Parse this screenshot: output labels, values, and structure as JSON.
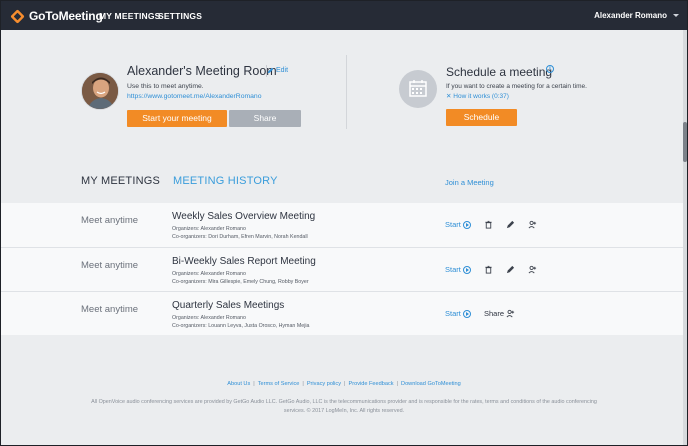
{
  "topbar": {
    "logo_text": "GoToMeeting",
    "nav": [
      "MY MEETINGS",
      "SETTINGS"
    ],
    "user_name": "Alexander Romano"
  },
  "room": {
    "title": "Alexander's Meeting Room",
    "edit_label": "Edit",
    "subtitle": "Use this to meet anytime.",
    "url": "https://www.gotomeet.me/AlexanderRomano",
    "start_label": "Start your meeting",
    "share_label": "Share"
  },
  "schedule": {
    "title": "Schedule a meeting",
    "info_icon": "i",
    "subtitle": "If you want to create a meeting for a certain time.",
    "how_it_works": "How it works (0:37)",
    "button_label": "Schedule"
  },
  "tabs": {
    "my_meetings": "MY MEETINGS",
    "meeting_history": "MEETING HISTORY",
    "join": "Join a Meeting"
  },
  "meetings": [
    {
      "when": "Meet anytime",
      "title": "Weekly Sales Overview Meeting",
      "organizers": "Organizers: Alexander Romano",
      "coorganizers": "Co-organizers: Dori  Durham, Efren Marvin, Norah  Kendall",
      "start_label": "Start",
      "actions": [
        "trash-icon",
        "pencil-icon",
        "add-person-icon"
      ]
    },
    {
      "when": "Meet anytime",
      "title": "Bi-Weekly Sales Report Meeting",
      "organizers": "Organizers: Alexander Romano",
      "coorganizers": "Co-organizers: Mira Gillespie, Emely Chung, Robby Boyer",
      "start_label": "Start",
      "actions": [
        "trash-icon",
        "pencil-icon",
        "add-person-icon"
      ]
    },
    {
      "when": "Meet anytime",
      "title": "Quarterly Sales Meetings",
      "organizers": "Organizers: Alexander Romano",
      "coorganizers": "Co-organizers: Louann Leyva, Justa Orosco, Hyman Mejia",
      "start_label": "Start",
      "share_label": "Share"
    }
  ],
  "footer": {
    "links": [
      "About Us",
      "Terms of Service",
      "Privacy policy",
      "Provide Feedback",
      "Download GoToMeeting"
    ],
    "legal": "All OpenVoice audio conferencing services are provided by GetGo Audio LLC. GetGo Audio, LLC is the telecommunications provider and is responsible for the rates, terms and conditions of the audio conferencing services. © 2017 LogMeIn, Inc. All rights reserved."
  },
  "colors": {
    "accent_orange": "#f28b25",
    "link_blue": "#2f8fd6",
    "topbar": "#262b36"
  }
}
